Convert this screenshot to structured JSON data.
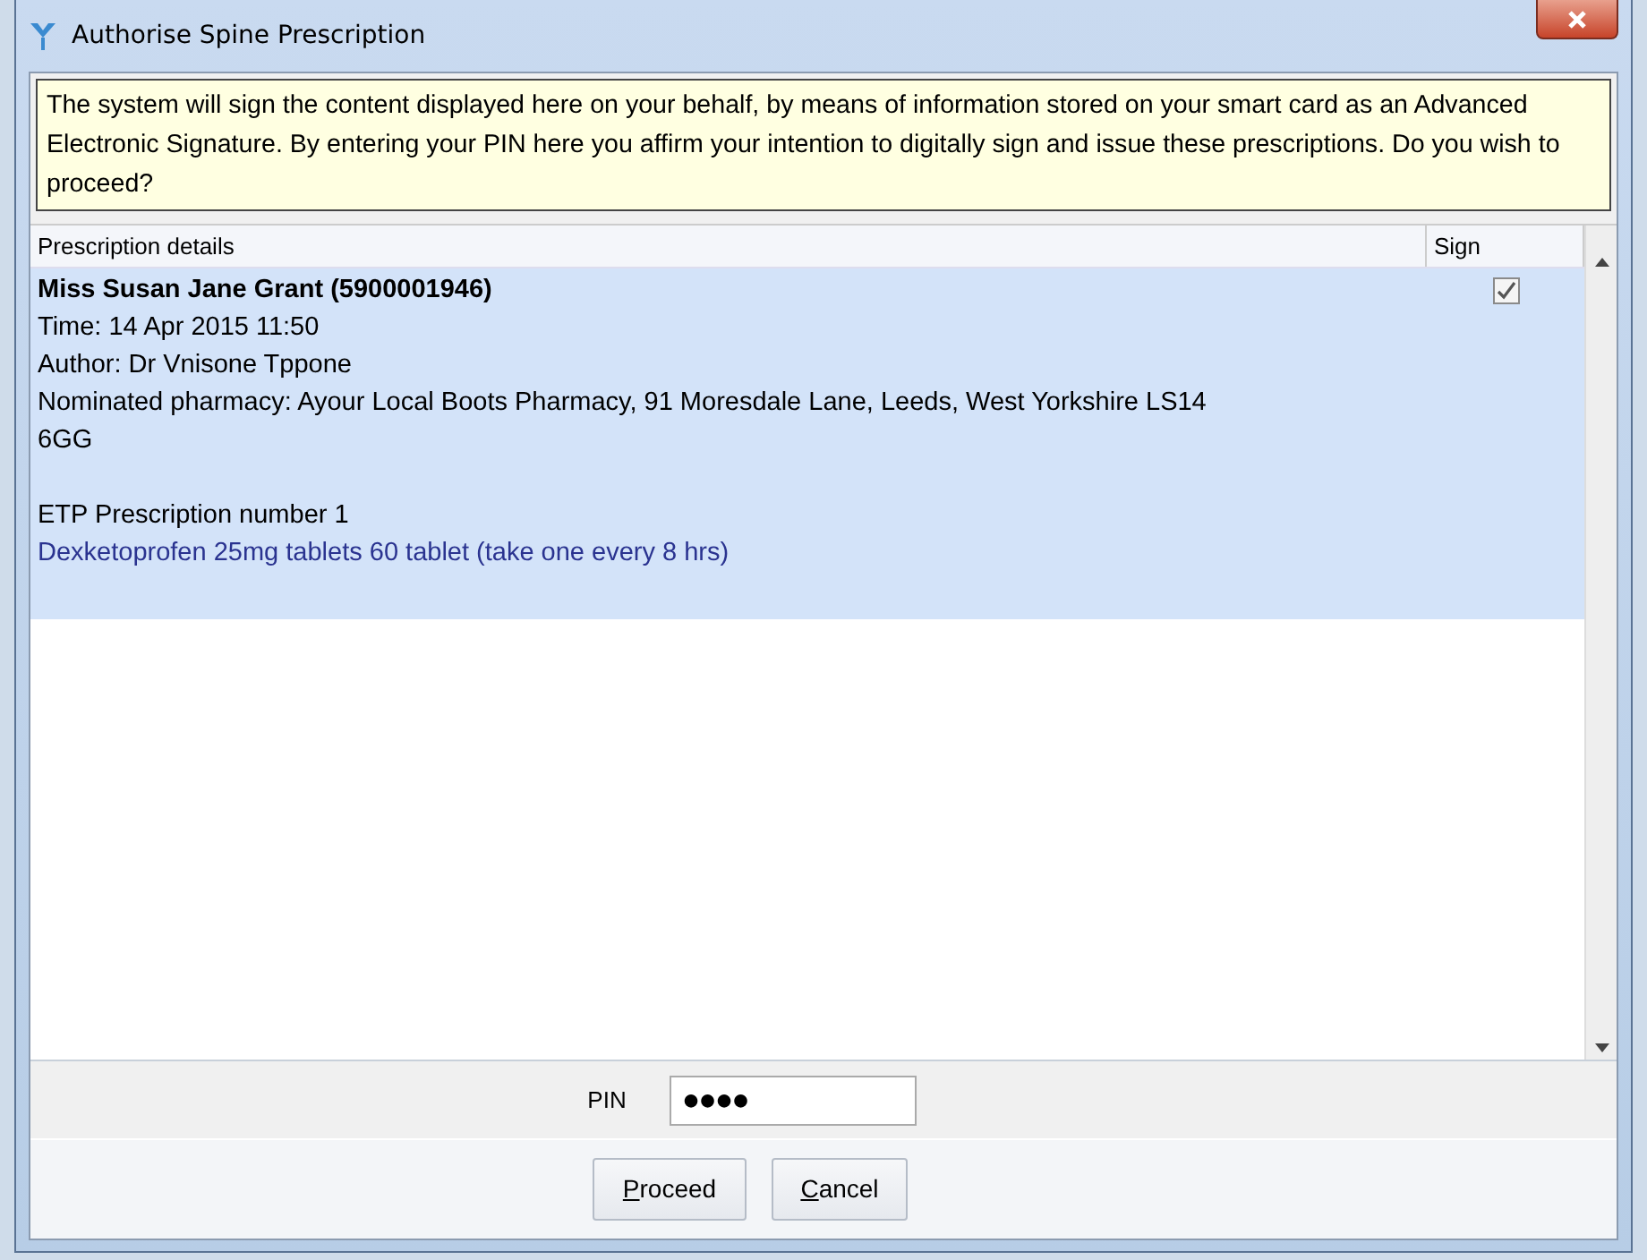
{
  "window": {
    "title": "Authorise Spine Prescription"
  },
  "notice": "The system will sign the content displayed here on your behalf, by means of information stored on your smart card as an Advanced Electronic Signature. By entering your PIN here you affirm your intention to digitally sign and issue these prescriptions. Do you wish to proceed?",
  "table": {
    "columns": [
      "Prescription details",
      "Sign"
    ],
    "rows": [
      {
        "selected": true,
        "checked": true,
        "lines": [
          {
            "kind": "patient",
            "text": "Miss Susan Jane Grant (5900001946)"
          },
          {
            "kind": "detail",
            "text": "Time: 14 Apr 2015 11:50"
          },
          {
            "kind": "detail",
            "text": "Author: Dr Vnisone Tppone"
          },
          {
            "kind": "detail",
            "text": "Nominated pharmacy: Ayour Local Boots Pharmacy, 91 Moresdale Lane, Leeds, West Yorkshire LS14 6GG"
          },
          {
            "kind": "section",
            "text": "ETP Prescription number 1"
          },
          {
            "kind": "item",
            "text": "Dexketoprofen 25mg tablets 60 tablet (take one every 8 hrs)"
          }
        ]
      }
    ]
  },
  "pin": {
    "label": "PIN",
    "value": "●●●●"
  },
  "buttons": [
    {
      "label": "Proceed",
      "underline_first": true
    },
    {
      "label": "Cancel",
      "underline_first": true
    }
  ]
}
